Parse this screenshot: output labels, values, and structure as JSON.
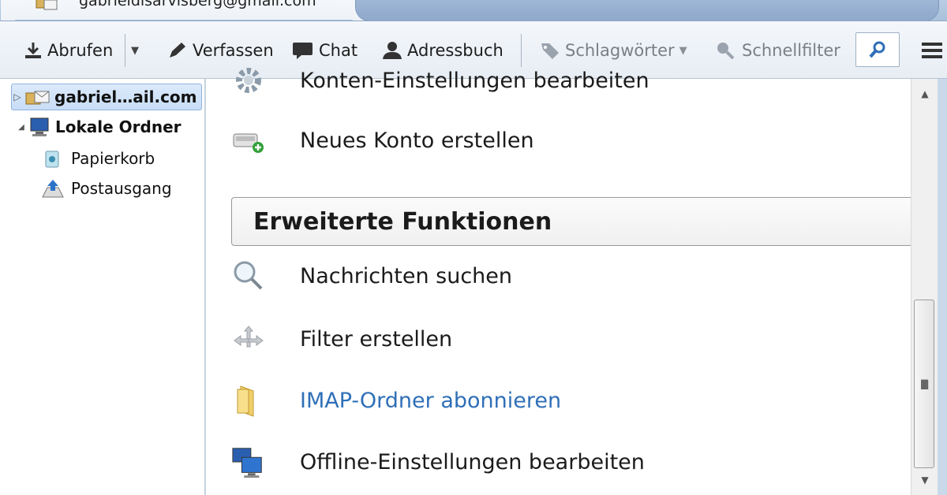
{
  "window": {
    "tab_title": "gabrieldisarvisberg@gmail.com",
    "tab_icon": "mail-account-icon"
  },
  "toolbar": {
    "get_mail": "Abrufen",
    "compose": "Verfassen",
    "chat": "Chat",
    "address_book": "Adressbuch",
    "tags": "Schlagwörter",
    "quick_filter": "Schnellfilter"
  },
  "sidebar": {
    "account": "gabriel…ail.com",
    "local_folders": "Lokale Ordner",
    "trash": "Papierkorb",
    "outbox": "Postausgang"
  },
  "main": {
    "account_settings": "Konten-Einstellungen bearbeiten",
    "new_account": "Neues Konto erstellen",
    "advanced_header": "Erweiterte Funktionen",
    "search_messages": "Nachrichten suchen",
    "create_filter": "Filter erstellen",
    "imap_subscribe": "IMAP-Ordner abonnieren",
    "offline_settings": "Offline-Einstellungen bearbeiten"
  },
  "colors": {
    "link": "#2f6fb7",
    "selection": "#c8ddf6",
    "frame": "#c9d9ea"
  }
}
